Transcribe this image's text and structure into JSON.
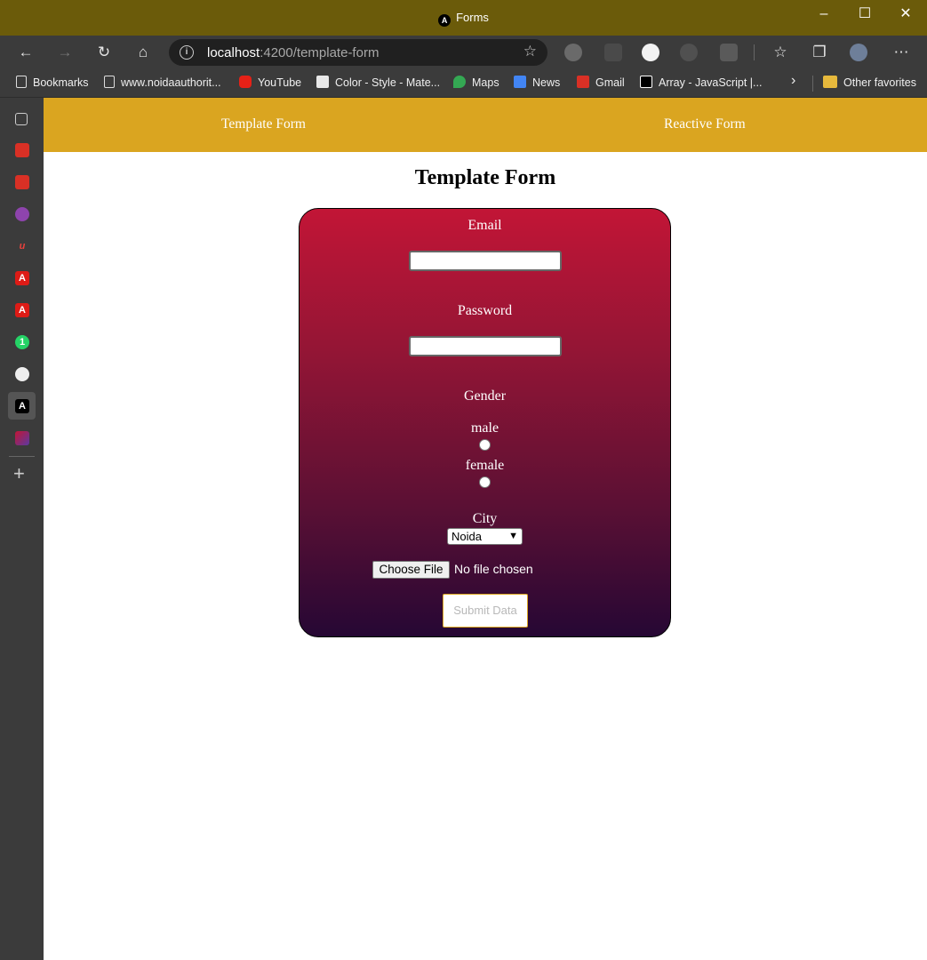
{
  "window": {
    "title": "Forms",
    "controls": {
      "minimize": "–",
      "maximize": "☐",
      "close": "✕"
    }
  },
  "toolbar": {
    "url_host": "localhost",
    "url_path": ":4200/template-form"
  },
  "bookmarks": [
    {
      "label": "Bookmarks",
      "icon": "page-icon"
    },
    {
      "label": "www.noidaauthorit...",
      "icon": "page-icon"
    },
    {
      "label": "YouTube",
      "icon": "youtube-icon"
    },
    {
      "label": "Color - Style - Mate...",
      "icon": "material-icon"
    },
    {
      "label": "Maps",
      "icon": "maps-icon"
    },
    {
      "label": "News",
      "icon": "news-icon"
    },
    {
      "label": "Gmail",
      "icon": "gmail-icon"
    },
    {
      "label": "Array - JavaScript |...",
      "icon": "mdn-icon"
    },
    {
      "label": "Other favorites",
      "icon": "folder-icon"
    }
  ],
  "app": {
    "nav": {
      "template": "Template Form",
      "reactive": "Reactive Form"
    },
    "heading": "Template Form",
    "form": {
      "email_label": "Email",
      "email_value": "",
      "password_label": "Password",
      "password_value": "",
      "gender_label": "Gender",
      "gender_options": [
        "male",
        "female"
      ],
      "city_label": "City",
      "city_selected": "Noida",
      "file_button": "Choose File",
      "file_status": "No file chosen",
      "submit_label": "Submit Data"
    }
  },
  "colors": {
    "app_nav": "#daa520",
    "card_top": "#c21536",
    "card_bottom": "#260734",
    "titlebar": "#6b5b0a"
  }
}
